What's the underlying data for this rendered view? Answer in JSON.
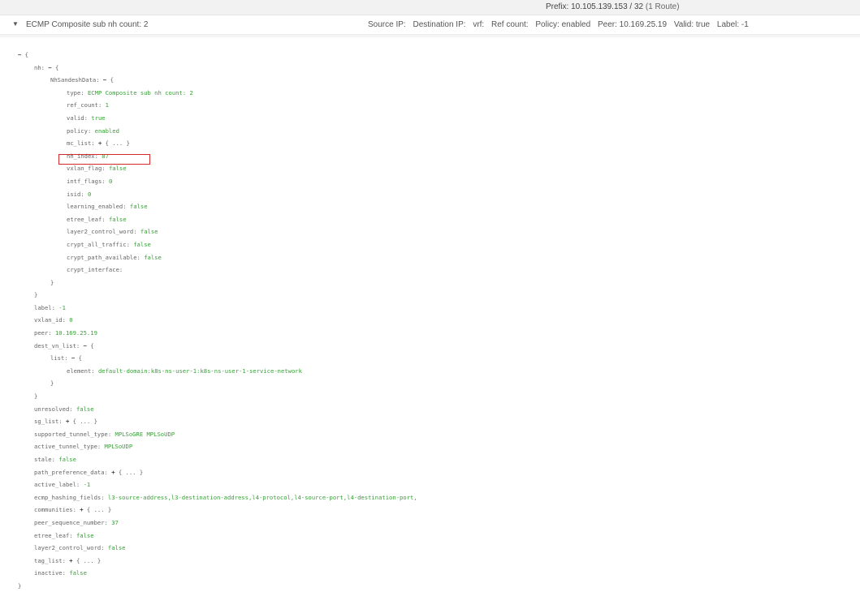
{
  "prefix_bar": {
    "label": "Prefix:",
    "prefix": "10.105.139.153 / 32",
    "route_count": "(1 Route)"
  },
  "route_row": {
    "caret_icon": "caret-down",
    "title": "ECMP Composite sub nh count: 2",
    "fields": [
      "Source IP:",
      "Destination IP:",
      "vrf:",
      "Ref count:",
      "Policy: enabled",
      "Peer: 10.169.25.19",
      "Valid: true",
      "Label: -1"
    ]
  },
  "json_tree": {
    "root_open": "{",
    "root_close": "}",
    "toggle_open": "−",
    "toggle_closed": "+",
    "collapsed_text": "{ ... }",
    "nh": {
      "key": "nh:",
      "nhsandesh": {
        "key": "NhSandeshData:",
        "fields": [
          {
            "key": "type:",
            "value": "ECMP Composite sub nh count: 2"
          },
          {
            "key": "ref_count:",
            "value": "1"
          },
          {
            "key": "valid:",
            "value": "true"
          },
          {
            "key": "policy:",
            "value": "enabled"
          },
          {
            "key": "mc_list:",
            "collapsed": true
          },
          {
            "key": "nh_index:",
            "value": "87",
            "highlighted": true
          },
          {
            "key": "vxlan_flag:",
            "value": "false"
          },
          {
            "key": "intf_flags:",
            "value": "0"
          },
          {
            "key": "isid:",
            "value": "0"
          },
          {
            "key": "learning_enabled:",
            "value": "false"
          },
          {
            "key": "etree_leaf:",
            "value": "false"
          },
          {
            "key": "layer2_control_word:",
            "value": "false"
          },
          {
            "key": "crypt_all_traffic:",
            "value": "false"
          },
          {
            "key": "crypt_path_available:",
            "value": "false"
          },
          {
            "key": "crypt_interface:",
            "value": ""
          }
        ]
      }
    },
    "fields_after_nh": [
      {
        "key": "label:",
        "value": "-1"
      },
      {
        "key": "vxlan_id:",
        "value": "0"
      },
      {
        "key": "peer:",
        "value": "10.169.25.19"
      }
    ],
    "dest_vn_list": {
      "key": "dest_vn_list:",
      "list_key": "list:",
      "element_key": "element:",
      "element_value": "default-domain:k8s-ns-user-1:k8s-ns-user-1-service-network"
    },
    "fields_tail": [
      {
        "key": "unresolved:",
        "value": "false"
      },
      {
        "key": "sg_list:",
        "collapsed": true
      },
      {
        "key": "supported_tunnel_type:",
        "value": "MPLSoGRE MPLSoUDP"
      },
      {
        "key": "active_tunnel_type:",
        "value": "MPLSoUDP"
      },
      {
        "key": "stale:",
        "value": "false"
      },
      {
        "key": "path_preference_data:",
        "collapsed": true
      },
      {
        "key": "active_label:",
        "value": "-1"
      },
      {
        "key": "ecmp_hashing_fields:",
        "value": "l3-source-address,l3-destination-address,l4-protocol,l4-source-port,l4-destination-port,"
      },
      {
        "key": "communities:",
        "collapsed": true
      },
      {
        "key": "peer_sequence_number:",
        "value": "37"
      },
      {
        "key": "etree_leaf:",
        "value": "false"
      },
      {
        "key": "layer2_control_word:",
        "value": "false"
      },
      {
        "key": "tag_list:",
        "collapsed": true
      },
      {
        "key": "inactive:",
        "value": "false"
      }
    ]
  }
}
